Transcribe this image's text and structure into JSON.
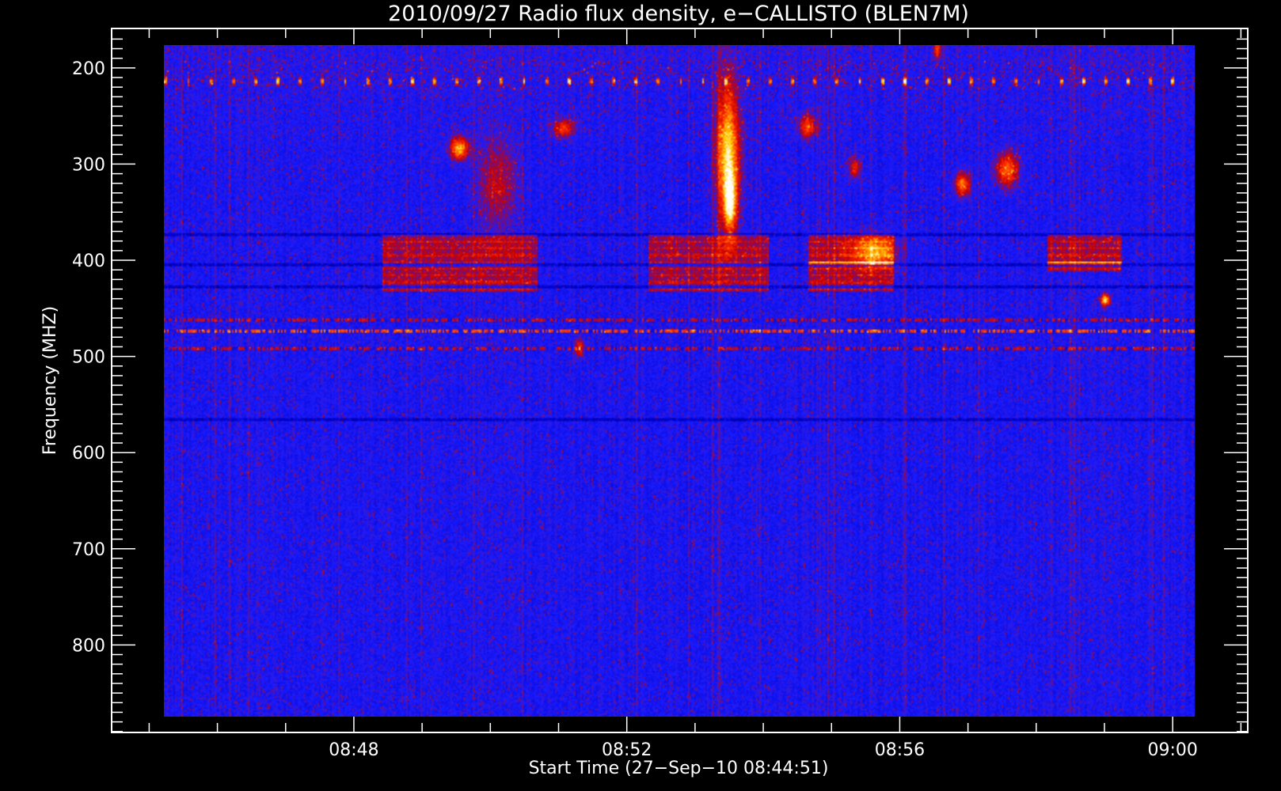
{
  "chart_data": {
    "type": "heatmap",
    "title": "2010/09/27  Radio flux density, e−CALLISTO (BLEN7M)",
    "xlabel": "Start Time (27−Sep−10 08:44:51)",
    "ylabel": "Frequency (MHZ)",
    "x_range_min": [
      0.15,
      16.4
    ],
    "x_axis_min": [
      -0.4,
      16.25
    ],
    "x_ticks": [
      {
        "value": 3.15,
        "label": "08:48"
      },
      {
        "value": 7.15,
        "label": "08:52"
      },
      {
        "value": 11.15,
        "label": "08:56"
      },
      {
        "value": 15.15,
        "label": "09:00"
      }
    ],
    "y_range_mhz": [
      176,
      874
    ],
    "y_axis_mhz": [
      159,
      891
    ],
    "y_ticks": [
      200,
      300,
      400,
      500,
      600,
      700,
      800
    ],
    "colorscale": [
      "#000000",
      "#0000c8",
      "#1a1aff",
      "#c80000",
      "#ff3000",
      "#ffd000",
      "#ffffff"
    ],
    "features": {
      "interference_pulse_freq_mhz": 213,
      "interference_pulse_count": 46,
      "rfi_lines_mhz": [
        462,
        473,
        491
      ],
      "dark_lines_mhz": [
        373,
        404,
        427,
        566
      ],
      "enhanced_blocks": [
        {
          "t": [
            3.6,
            6.05
          ],
          "f": [
            372,
            432
          ]
        },
        {
          "t": [
            7.8,
            9.7
          ],
          "f": [
            372,
            432
          ]
        },
        {
          "t": [
            10.3,
            11.65
          ],
          "f": [
            372,
            432
          ]
        },
        {
          "t": [
            14.1,
            15.25
          ],
          "f": [
            372,
            410
          ]
        }
      ],
      "bursts": [
        {
          "t": 9.05,
          "f": 290,
          "df": 60,
          "dt": 0.15,
          "i": 1.0
        },
        {
          "t": 9.08,
          "f": 340,
          "df": 25,
          "dt": 0.08,
          "i": 0.75
        },
        {
          "t": 4.8,
          "f": 283,
          "df": 10,
          "dt": 0.12,
          "i": 0.85
        },
        {
          "t": 6.45,
          "f": 262,
          "df": 8,
          "dt": 0.15,
          "i": 0.55
        },
        {
          "t": 10.3,
          "f": 260,
          "df": 10,
          "dt": 0.12,
          "i": 0.6
        },
        {
          "t": 11.35,
          "f": 390,
          "df": 15,
          "dt": 0.3,
          "i": 0.6
        },
        {
          "t": 11.05,
          "f": 303,
          "df": 10,
          "dt": 0.08,
          "i": 0.5
        },
        {
          "t": 12.75,
          "f": 320,
          "df": 10,
          "dt": 0.1,
          "i": 0.75
        },
        {
          "t": 13.45,
          "f": 305,
          "df": 15,
          "dt": 0.15,
          "i": 0.7
        },
        {
          "t": 15.0,
          "f": 441,
          "df": 5,
          "dt": 0.06,
          "i": 1.0
        },
        {
          "t": 6.7,
          "f": 490,
          "df": 8,
          "dt": 0.06,
          "i": 0.55
        },
        {
          "t": 5.4,
          "f": 320,
          "df": 40,
          "dt": 0.25,
          "i": 0.35
        },
        {
          "t": 12.35,
          "f": 180,
          "df": 8,
          "dt": 0.05,
          "i": 0.6
        }
      ]
    }
  }
}
